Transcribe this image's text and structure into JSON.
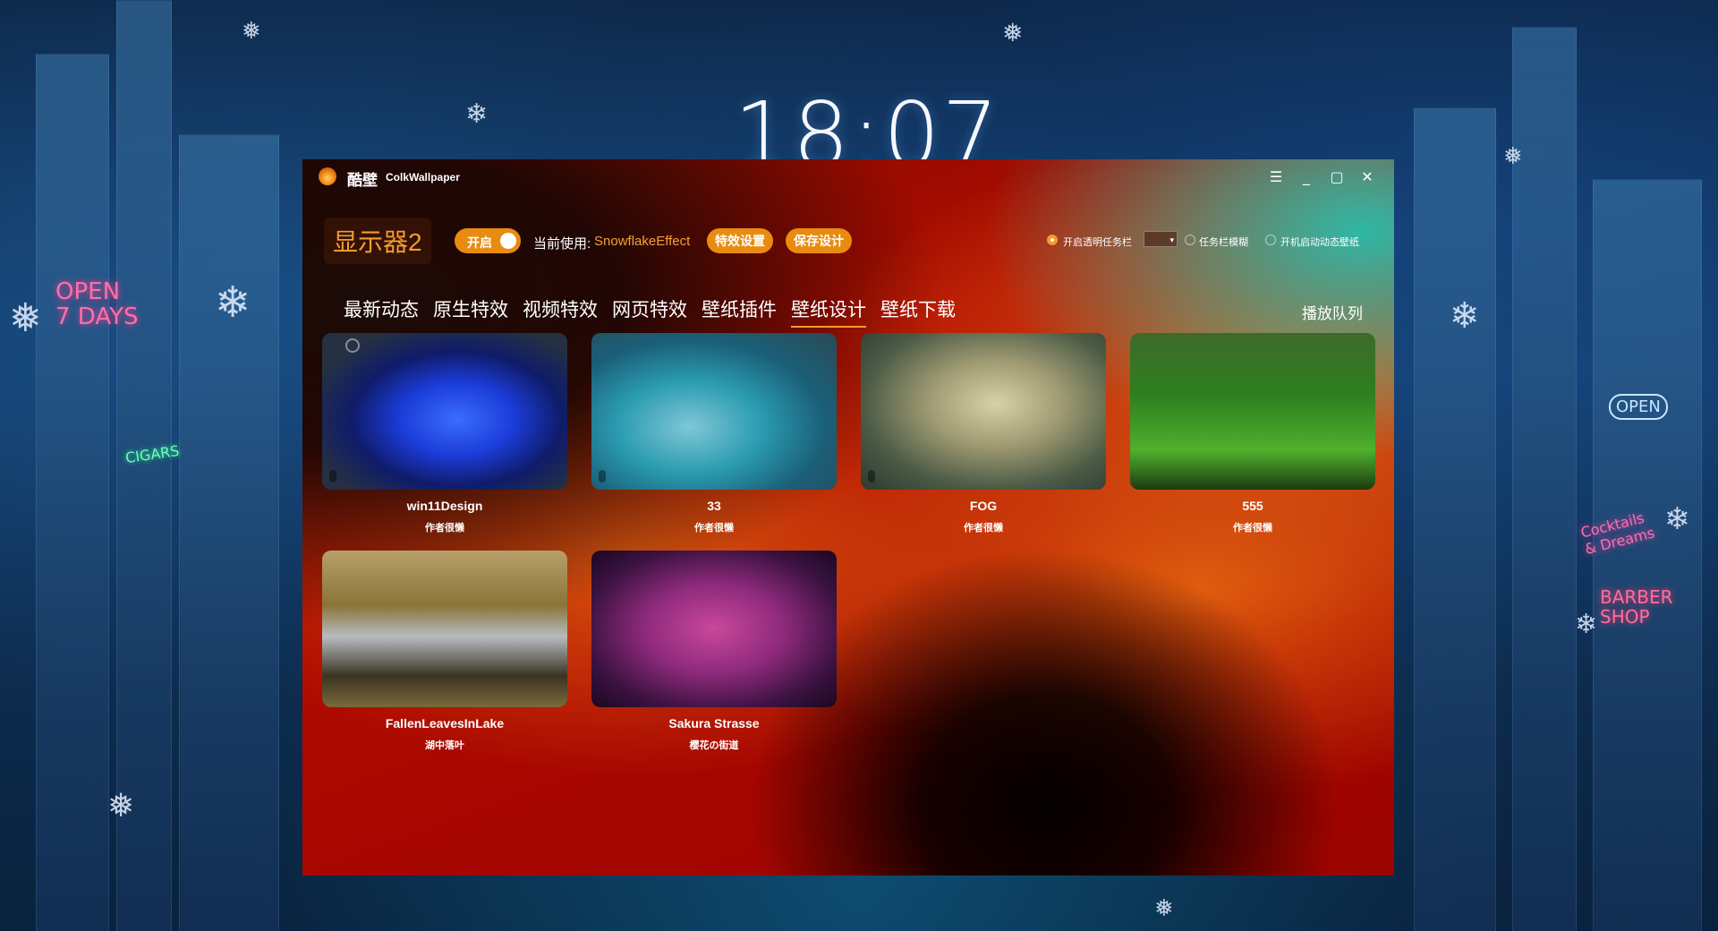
{
  "desktop": {
    "clock": "18:07",
    "neon_signs": [
      "OPEN\n7 DAYS",
      "CIGARS",
      "OPEN",
      "BARBER\nSHOP",
      "Cocktails & Dreams"
    ]
  },
  "window": {
    "app_name_cn": "酷壁",
    "app_name_en": "ColkWallpaper",
    "controls": {
      "menu_icon": "menu-icon",
      "minimize_icon": "minimize-icon",
      "maximize_icon": "maximize-icon",
      "close_icon": "close-icon"
    }
  },
  "toolbar": {
    "monitor_label": "显示器2",
    "toggle_label": "开启",
    "toggle_on": true,
    "current_label": "当前使用:",
    "current_effect": "SnowflakeEffect",
    "effect_settings_label": "特效设置",
    "save_design_label": "保存设计",
    "options": [
      {
        "label": "开启透明任务栏",
        "checked": true
      },
      {
        "label": "任务栏模糊",
        "checked": false
      },
      {
        "label": "开机启动动态壁纸",
        "checked": false
      }
    ]
  },
  "nav": {
    "tabs": [
      "最新动态",
      "原生特效",
      "视频特效",
      "网页特效",
      "壁纸插件",
      "壁纸设计",
      "壁纸下载"
    ],
    "active": "壁纸设计",
    "queue_label": "播放队列"
  },
  "cards": [
    {
      "title": "win11Design",
      "author": "作者很懒"
    },
    {
      "title": "33",
      "author": "作者很懒"
    },
    {
      "title": "FOG",
      "author": "作者很懒"
    },
    {
      "title": "555",
      "author": "作者很懒"
    },
    {
      "title": "FallenLeavesInLake",
      "author": "湖中落叶"
    },
    {
      "title": "Sakura Strasse",
      "author": "樱花の街道"
    }
  ],
  "colors": {
    "accent": "#e98b10",
    "accent_text": "#f39c2f",
    "window_bg": "#b20c00"
  }
}
